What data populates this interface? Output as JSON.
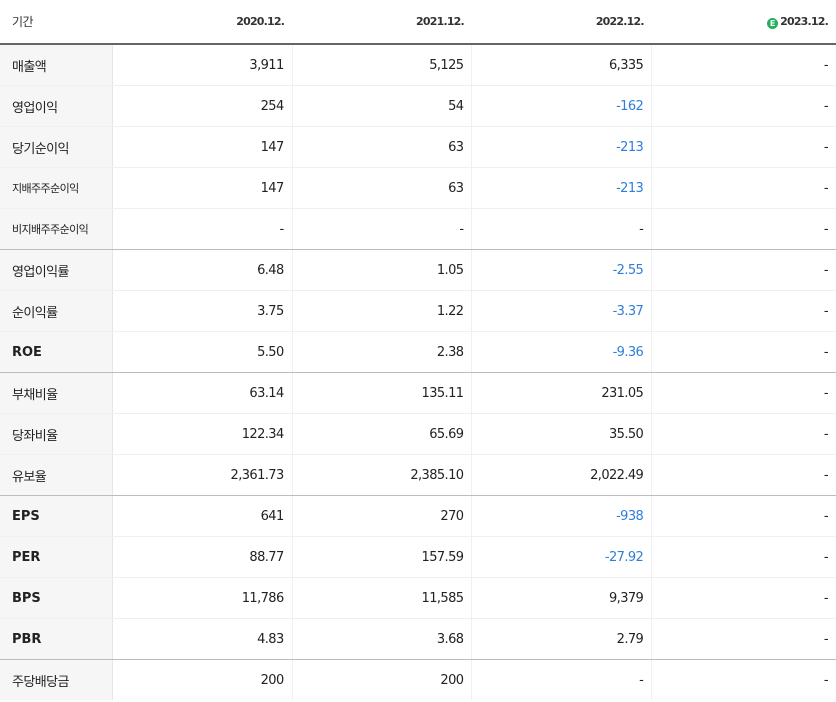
{
  "header": {
    "label": "기간",
    "years": [
      "2020.12.",
      "2021.12.",
      "2022.12.",
      "2023.12."
    ],
    "estimate_badge": "E"
  },
  "colors": {
    "negative": "#2f7ed8",
    "estimate_badge": "#22b15c"
  },
  "rows": [
    {
      "label": "매출액",
      "values": [
        "3,911",
        "5,125",
        "6,335",
        "-"
      ]
    },
    {
      "label": "영업이익",
      "values": [
        "254",
        "54",
        "-162",
        "-"
      ]
    },
    {
      "label": "당기순이익",
      "values": [
        "147",
        "63",
        "-213",
        "-"
      ]
    },
    {
      "label": "지배주주순이익",
      "values": [
        "147",
        "63",
        "-213",
        "-"
      ]
    },
    {
      "label": "비지배주주순이익",
      "values": [
        "-",
        "-",
        "-",
        "-"
      ]
    },
    {
      "label": "영업이익률",
      "values": [
        "6.48",
        "1.05",
        "-2.55",
        "-"
      ]
    },
    {
      "label": "순이익률",
      "values": [
        "3.75",
        "1.22",
        "-3.37",
        "-"
      ]
    },
    {
      "label": "ROE",
      "values": [
        "5.50",
        "2.38",
        "-9.36",
        "-"
      ]
    },
    {
      "label": "부채비율",
      "values": [
        "63.14",
        "135.11",
        "231.05",
        "-"
      ]
    },
    {
      "label": "당좌비율",
      "values": [
        "122.34",
        "65.69",
        "35.50",
        "-"
      ]
    },
    {
      "label": "유보율",
      "values": [
        "2,361.73",
        "2,385.10",
        "2,022.49",
        "-"
      ]
    },
    {
      "label": "EPS",
      "values": [
        "641",
        "270",
        "-938",
        "-"
      ]
    },
    {
      "label": "PER",
      "values": [
        "88.77",
        "157.59",
        "-27.92",
        "-"
      ]
    },
    {
      "label": "BPS",
      "values": [
        "11,786",
        "11,585",
        "9,379",
        "-"
      ]
    },
    {
      "label": "PBR",
      "values": [
        "4.83",
        "3.68",
        "2.79",
        "-"
      ]
    },
    {
      "label": "주당배당금",
      "values": [
        "200",
        "200",
        "-",
        "-"
      ]
    }
  ]
}
